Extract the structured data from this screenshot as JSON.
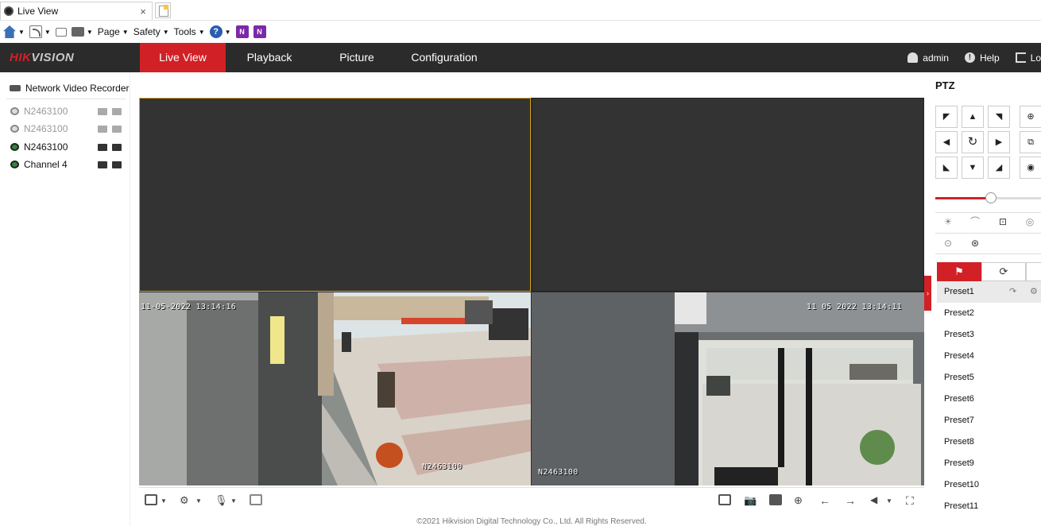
{
  "browser": {
    "tab_title": "Live View",
    "tab_close": "×",
    "menus": [
      {
        "label": "Page"
      },
      {
        "label": "Safety"
      },
      {
        "label": "Tools"
      }
    ]
  },
  "app": {
    "logo_main": "HIK",
    "logo_rest": "VISION",
    "nav": [
      {
        "label": "Live View",
        "active": true
      },
      {
        "label": "Playback"
      },
      {
        "label": "Picture"
      },
      {
        "label": "Configuration"
      }
    ],
    "user": "admin",
    "help": "Help",
    "logout": "Lo"
  },
  "device_tree": {
    "root": "Network Video Recorder",
    "channels": [
      {
        "name": "N2463100",
        "online": false
      },
      {
        "name": "N2463100",
        "online": false
      },
      {
        "name": "N2463100",
        "online": true
      },
      {
        "name": "Channel 4",
        "online": true
      }
    ]
  },
  "video": {
    "cell3": {
      "timestamp": "11-05-2022 13:14:16",
      "name": "N2463100"
    },
    "cell4": {
      "timestamp": "11 05 2022 13:14:11",
      "name": "N2463100"
    }
  },
  "footer": "©2021 Hikvision Digital Technology Co., Ltd. All Rights Reserved.",
  "ptz": {
    "title": "PTZ",
    "speed": 0.5,
    "presets": [
      "Preset1",
      "Preset2",
      "Preset3",
      "Preset4",
      "Preset5",
      "Preset6",
      "Preset7",
      "Preset8",
      "Preset9",
      "Preset10",
      "Preset11"
    ]
  },
  "colors": {
    "accent": "#d12126",
    "header": "#2b2b2b"
  }
}
